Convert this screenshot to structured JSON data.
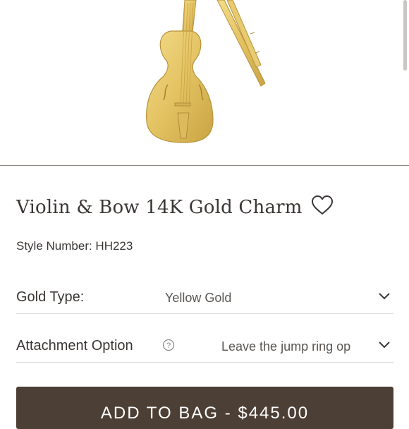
{
  "product": {
    "image_icon": "violin-and-bow-charm-image",
    "title": "Violin & Bow 14K Gold Charm",
    "style_number": "Style Number: HH223",
    "wishlist_icon": "heart-outline-icon"
  },
  "options": {
    "gold_type": {
      "label": "Gold Type:",
      "value": "Yellow Gold"
    },
    "attachment": {
      "label": "Attachment Option",
      "value": "Leave the jump ring op"
    }
  },
  "cart": {
    "button_label": "ADD TO BAG - $445.00"
  },
  "colors": {
    "gold": "#e6c76a",
    "button_bg": "#4c3f35",
    "text": "#3a3634"
  }
}
